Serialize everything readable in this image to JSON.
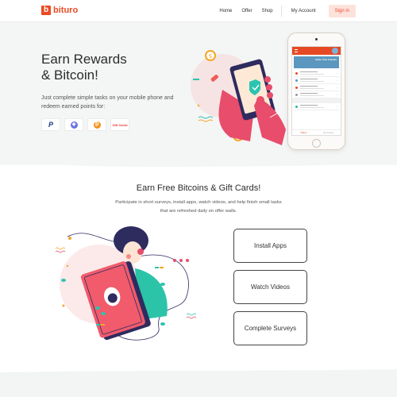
{
  "header": {
    "logo_mark": "b",
    "logo_text": "bituro",
    "nav": [
      "Home",
      "Offer",
      "Shop"
    ],
    "account_label": "My Account",
    "signin_label": "Sign in"
  },
  "hero": {
    "title_line1": "Earn Rewards",
    "title_line2": "& Bitcoin!",
    "subtitle": "Just complete simple tasks on your mobile phone and redeem earned points for:",
    "payment_methods": [
      {
        "name": "PayPal",
        "icon": "paypal-icon",
        "glyph": "P"
      },
      {
        "name": "Ethereum",
        "icon": "ethereum-icon",
        "glyph": "◆",
        "color": "#6b74e6"
      },
      {
        "name": "Bitcoin",
        "icon": "bitcoin-icon",
        "glyph": "₿",
        "color": "#f5921b"
      },
      {
        "name": "Gift Cards",
        "icon": "gift-cards-icon",
        "glyph": "Gift Cards"
      }
    ],
    "phone": {
      "invite_text": "Invite Your Friends",
      "tab_left": "Offers",
      "tab_right": "My Points"
    }
  },
  "section2": {
    "title": "Earn Free Bitcoins & Gift Cards!",
    "subtitle": "Participate in short surveys, install apps, watch videos, and help finish small tasks that are refreshed daily on offer walls.",
    "tasks": [
      "Install Apps",
      "Watch Videos",
      "Complete Surveys"
    ]
  },
  "colors": {
    "brand": "#e64a24",
    "signin_bg": "#fde2dc",
    "hero_bg": "#f4f5f5"
  }
}
